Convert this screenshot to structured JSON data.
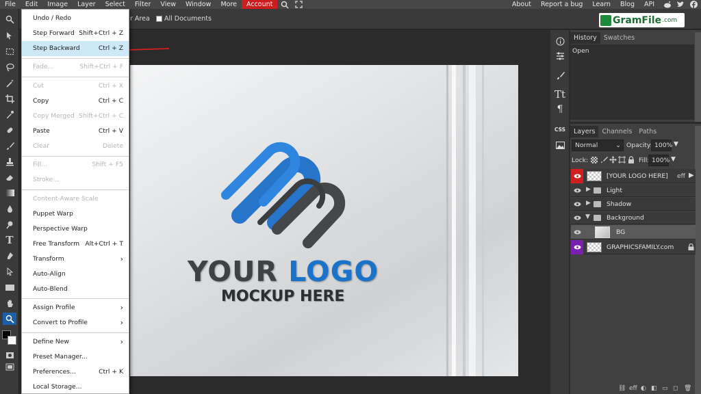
{
  "menubar": {
    "items": [
      "File",
      "Edit",
      "Image",
      "Layer",
      "Select",
      "Filter",
      "View",
      "Window",
      "More",
      "Account"
    ],
    "right_items": [
      "About",
      "Report a bug",
      "Learn",
      "Blog",
      "API"
    ],
    "active_color": "#cc1e1e"
  },
  "options": {
    "area_label": "r Area",
    "all_documents_label": "All Documents"
  },
  "watermark": {
    "brand": "GramFile",
    "suffix": ".com"
  },
  "edit_menu": {
    "items": [
      {
        "label": "Undo / Redo",
        "shortcut": ""
      },
      {
        "label": "Step Forward",
        "shortcut": "Shift+Ctrl + Z"
      },
      {
        "label": "Step Backward",
        "shortcut": "Ctrl + Z"
      },
      {
        "label": "Fade...",
        "shortcut": "Shift+Ctrl + F"
      },
      {
        "label": "Cut",
        "shortcut": "Ctrl + X"
      },
      {
        "label": "Copy",
        "shortcut": "Ctrl + C"
      },
      {
        "label": "Copy Merged",
        "shortcut": "Shift+Ctrl + C"
      },
      {
        "label": "Paste",
        "shortcut": "Ctrl + V"
      },
      {
        "label": "Clear",
        "shortcut": "Delete"
      },
      {
        "label": "Fill...",
        "shortcut": "Shift + F5"
      },
      {
        "label": "Stroke...",
        "shortcut": ""
      },
      {
        "label": "Content-Aware Scale",
        "shortcut": ""
      },
      {
        "label": "Puppet Warp",
        "shortcut": ""
      },
      {
        "label": "Perspective Warp",
        "shortcut": ""
      },
      {
        "label": "Free Transform",
        "shortcut": "Alt+Ctrl + T"
      },
      {
        "label": "Transform",
        "shortcut": ""
      },
      {
        "label": "Auto-Align",
        "shortcut": ""
      },
      {
        "label": "Auto-Blend",
        "shortcut": ""
      },
      {
        "label": "Assign Profile",
        "shortcut": ""
      },
      {
        "label": "Convert to Profile",
        "shortcut": ""
      },
      {
        "label": "Define New",
        "shortcut": ""
      },
      {
        "label": "Preset Manager...",
        "shortcut": ""
      },
      {
        "label": "Preferences...",
        "shortcut": "Ctrl + K"
      },
      {
        "label": "Local Storage...",
        "shortcut": ""
      }
    ]
  },
  "canvas": {
    "title_part1": "YOUR ",
    "title_part2": "LOGO",
    "subtitle": "MOCKUP HERE"
  },
  "history_panel": {
    "tabs": [
      "History",
      "Swatches"
    ],
    "entries": [
      "Open"
    ]
  },
  "layers_panel": {
    "tabs": [
      "Layers",
      "Channels",
      "Paths"
    ],
    "blend_mode": "Normal",
    "opacity_label": "Opacity:",
    "opacity_value": "100%",
    "lock_label": "Lock:",
    "fill_label": "Fill:",
    "fill_value": "100%",
    "layers": [
      "[YOUR LOGO HERE]",
      "Light",
      "Shadow",
      "Background",
      "BG",
      "GRAPHICSFAMILY.com"
    ],
    "eff_label": "eff",
    "bottom_eff": "eff"
  },
  "side_panel": {
    "css_label": "CSS"
  }
}
